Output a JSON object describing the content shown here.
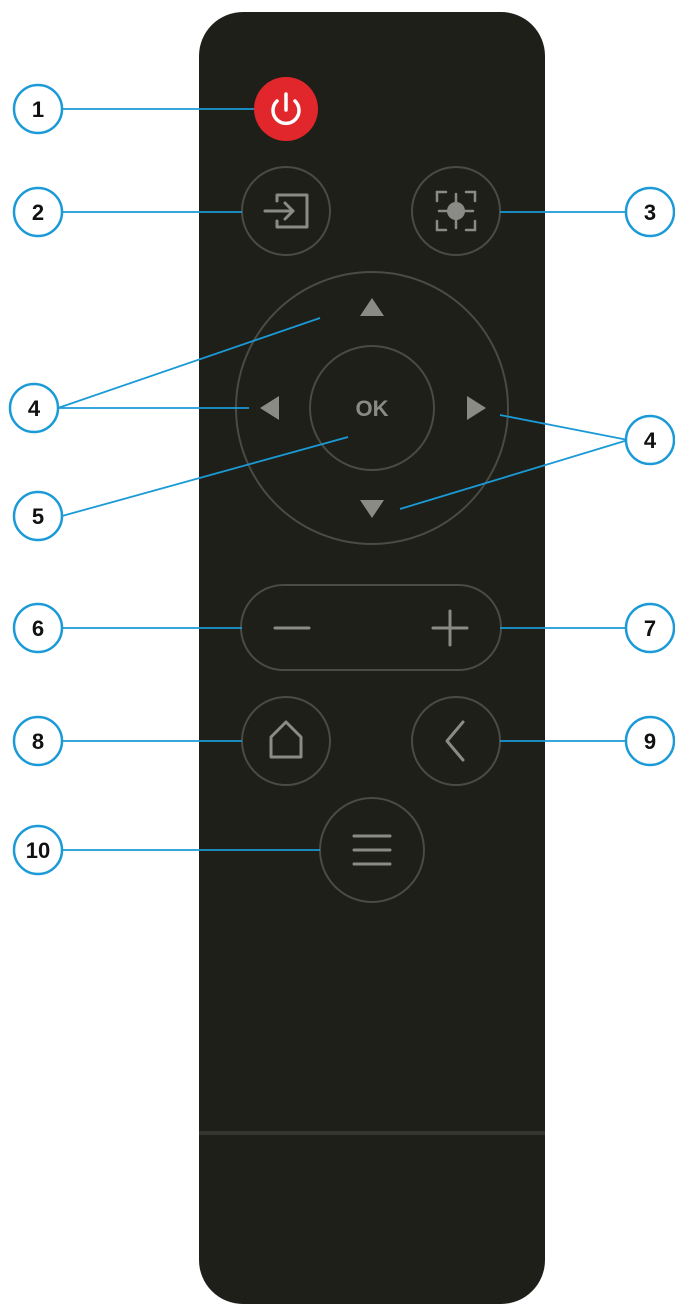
{
  "remote": {
    "ok_label": "OK"
  },
  "callouts": [
    {
      "id": "power",
      "number": "1"
    },
    {
      "id": "input",
      "number": "2"
    },
    {
      "id": "focus",
      "number": "3"
    },
    {
      "id": "direction-left",
      "number": "4"
    },
    {
      "id": "direction-right",
      "number": "4"
    },
    {
      "id": "ok",
      "number": "5"
    },
    {
      "id": "volume-down",
      "number": "6"
    },
    {
      "id": "volume-up",
      "number": "7"
    },
    {
      "id": "home",
      "number": "8"
    },
    {
      "id": "back",
      "number": "9"
    },
    {
      "id": "menu",
      "number": "10"
    }
  ],
  "colors": {
    "remote_body": "#1e1f19",
    "button_outline": "#4a4a46",
    "icon": "#8a8a86",
    "power": "#e1262c",
    "leader_line": "#1a9ad6",
    "callout_border": "#1a9ad6"
  }
}
